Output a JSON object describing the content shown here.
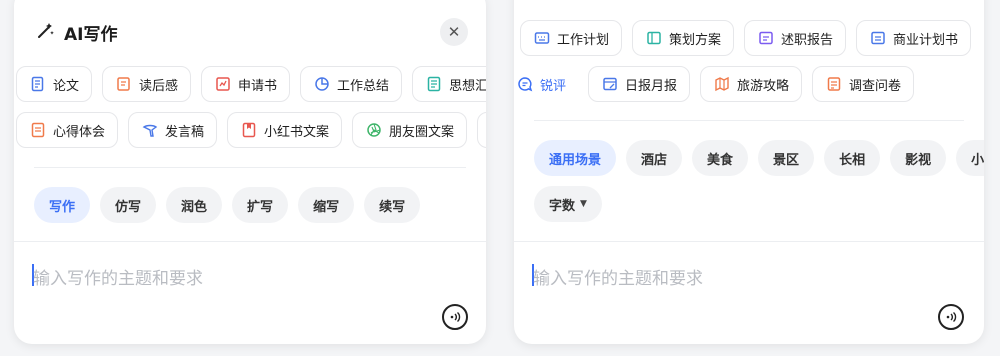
{
  "left": {
    "title": "AI写作",
    "close_label": "✕",
    "row1": [
      "论文",
      "读后感",
      "申请书",
      "工作总结",
      "思想汇报"
    ],
    "row2": [
      "心得体会",
      "发言稿",
      "小红书文案",
      "朋友圈文案"
    ],
    "modes": [
      "写作",
      "仿写",
      "润色",
      "扩写",
      "缩写",
      "续写"
    ],
    "input_placeholder": "输入写作的主题和要求"
  },
  "right": {
    "row1": [
      "工作计划",
      "策划方案",
      "述职报告",
      "商业计划书"
    ],
    "row2": [
      "锐评",
      "日报月报",
      "旅游攻略",
      "调查问卷"
    ],
    "scenes": [
      "通用场景",
      "酒店",
      "美食",
      "景区",
      "长相",
      "影视",
      "小说"
    ],
    "word_count_label": "字数",
    "input_placeholder": "输入写作的主题和要求"
  },
  "colors": {
    "accent": "#3b6ff5",
    "icon_blue": "#4a78e8",
    "icon_orange": "#f07a4a",
    "icon_red": "#e8574f",
    "icon_teal": "#2bb3a3",
    "icon_green": "#3fb56a",
    "icon_purple": "#7b5cf0"
  }
}
